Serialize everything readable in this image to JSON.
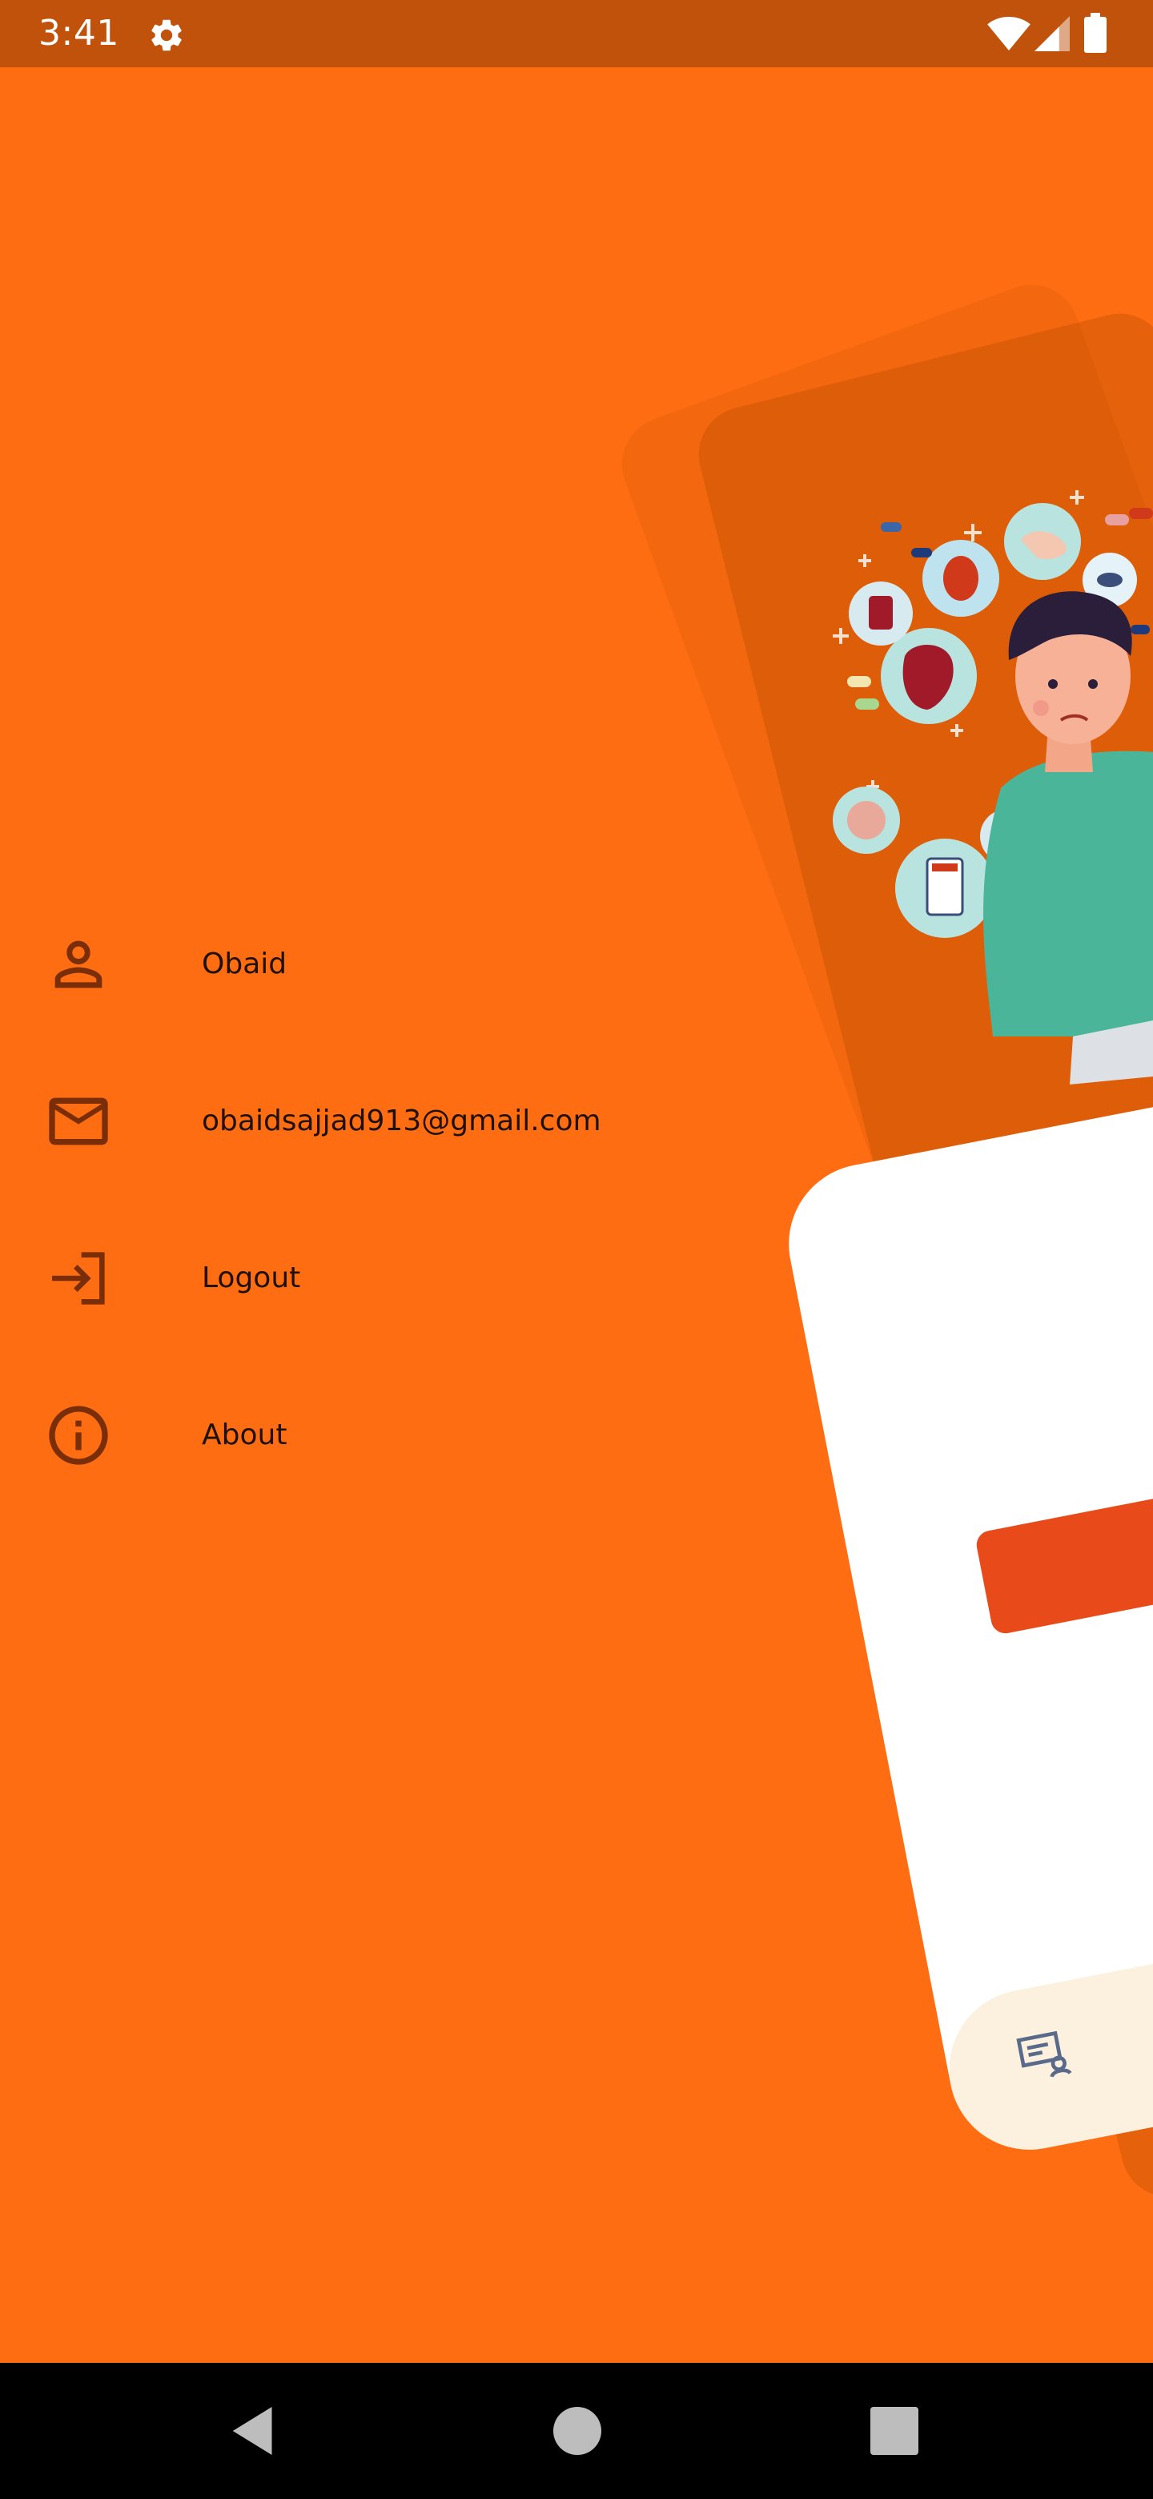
{
  "status_bar": {
    "time": "3:41",
    "icons": [
      "gear-icon",
      "wifi-icon",
      "signal-icon",
      "battery-icon"
    ]
  },
  "drawer": {
    "items": [
      {
        "label": "Obaid",
        "icon": "person-icon"
      },
      {
        "label": "obaidsajjad913@gmail.com",
        "icon": "mail-icon"
      },
      {
        "label": "Logout",
        "icon": "logout-icon"
      },
      {
        "label": "About",
        "icon": "info-icon"
      }
    ]
  },
  "colors": {
    "background": "#FF6D12",
    "status_bar": "#C0520C",
    "icon": "#7A2E08",
    "button": "#E84A1A",
    "card": "#FFFFFF",
    "card_nav": "#FCF1DF"
  },
  "navigation": {
    "buttons": [
      "back-icon",
      "home-icon",
      "recents-icon"
    ]
  }
}
